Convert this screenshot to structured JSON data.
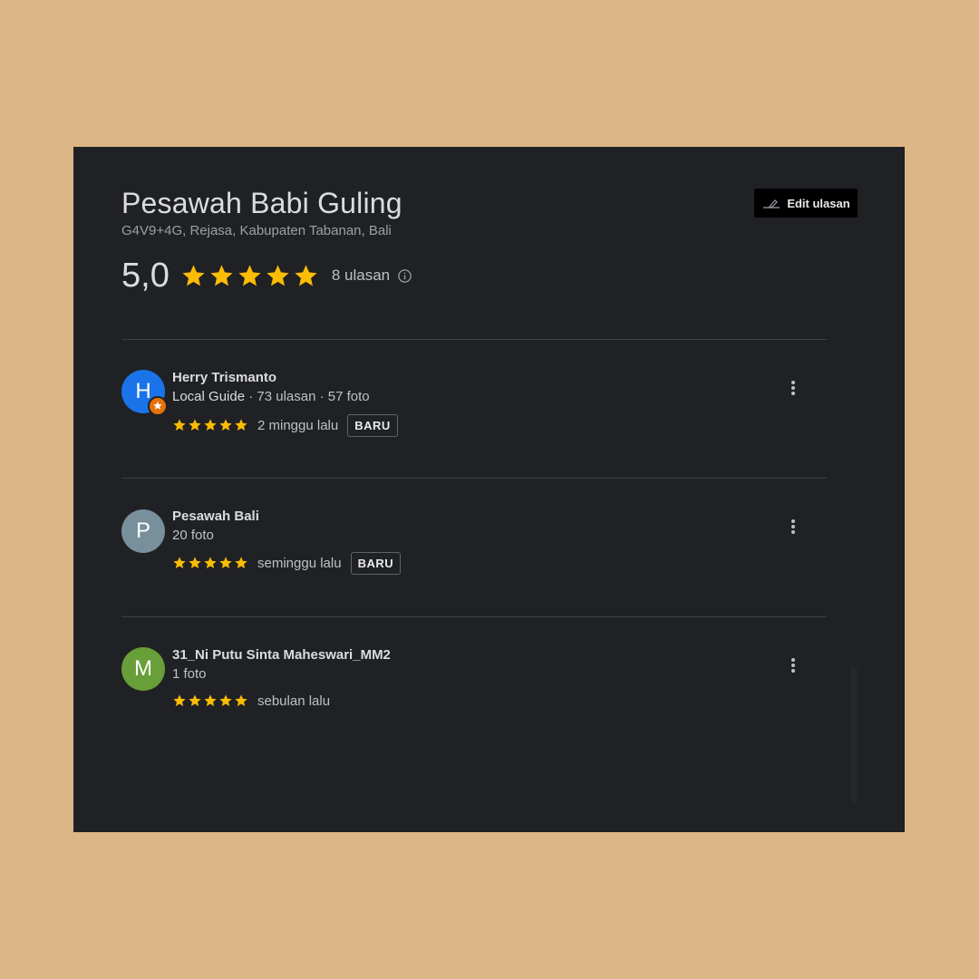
{
  "place": {
    "name": "Pesawah Babi Guling",
    "address": "G4V9+4G, Rejasa, Kabupaten Tabanan, Bali"
  },
  "edit_button": {
    "label": "Edit ulasan",
    "icon": "pencil-icon"
  },
  "rating": {
    "value": "5,0",
    "stars": 5,
    "count_text": "8 ulasan",
    "info_icon": "info-icon"
  },
  "colors": {
    "star": "#fbbc04",
    "background": "#202124",
    "page_background": "#dcb687"
  },
  "reviews": [
    {
      "initial": "H",
      "avatar_color": "#1a73e8",
      "local_guide_badge": true,
      "name": "Herry Trismanto",
      "meta_label": "Local Guide",
      "meta": " · 73 ulasan · 57 foto",
      "stars": 5,
      "date": "2 minggu lalu",
      "badge": "BARU"
    },
    {
      "initial": "P",
      "avatar_color": "#78909c",
      "local_guide_badge": false,
      "name": "Pesawah Bali",
      "meta_label": "",
      "meta": "20 foto",
      "stars": 5,
      "date": "seminggu lalu",
      "badge": "BARU"
    },
    {
      "initial": "M",
      "avatar_color": "#689f38",
      "local_guide_badge": false,
      "name": "31_Ni Putu Sinta Maheswari_MM2",
      "meta_label": "",
      "meta": "1 foto",
      "stars": 5,
      "date": "sebulan lalu",
      "badge": ""
    }
  ]
}
